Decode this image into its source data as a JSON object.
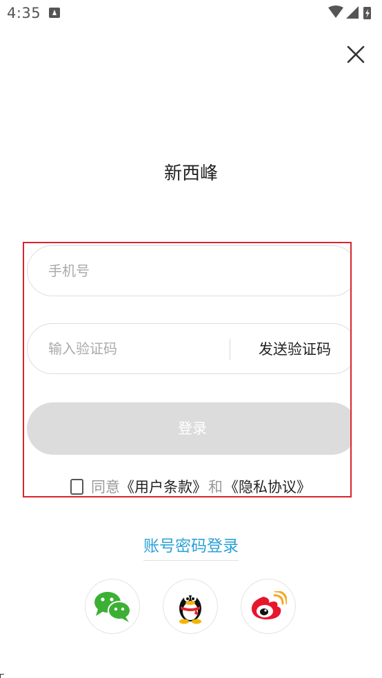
{
  "status_bar": {
    "time": "4:35",
    "icons": [
      "notification-a-icon",
      "wifi-icon",
      "signal-icon",
      "battery-charging-icon"
    ]
  },
  "app": {
    "title": "新西峰"
  },
  "form": {
    "phone_placeholder": "手机号",
    "code_placeholder": "输入验证码",
    "send_code_label": "发送验证码",
    "login_label": "登录",
    "agree_prefix": "同意",
    "terms_link": "《用户条款》",
    "agree_and": "和",
    "privacy_link": "《隐私协议》"
  },
  "alt_login": {
    "password_login_label": "账号密码登录"
  },
  "social": [
    {
      "name": "wechat",
      "icon": "wechat-icon",
      "color": "#3cb034"
    },
    {
      "name": "qq",
      "icon": "qq-penguin-icon",
      "color": "#111111"
    },
    {
      "name": "weibo",
      "icon": "weibo-icon",
      "color": "#e6162d"
    }
  ],
  "colors": {
    "accent_link": "#2aa1d6",
    "highlight_border": "#d9232b",
    "login_disabled": "#dcdcdc"
  }
}
